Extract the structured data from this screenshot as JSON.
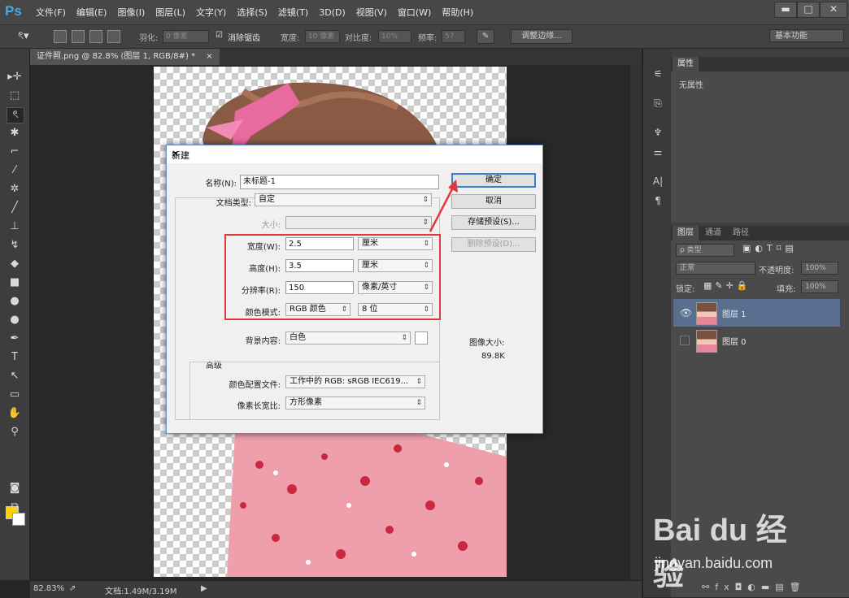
{
  "menubar": {
    "logo": "Ps",
    "items": [
      "文件(F)",
      "编辑(E)",
      "图像(I)",
      "图层(L)",
      "文字(Y)",
      "选择(S)",
      "滤镜(T)",
      "3D(D)",
      "视图(V)",
      "窗口(W)",
      "帮助(H)"
    ],
    "minimize": "▬",
    "maximize": "□",
    "close": "✕"
  },
  "options": {
    "feather_label": "羽化:",
    "feather_value": "0 像素",
    "antialias_label": "消除锯齿",
    "width_label": "宽度:",
    "width_value": "10 像素",
    "contrast_label": "对比度:",
    "contrast_value": "10%",
    "frequency_label": "频率:",
    "frequency_value": "57",
    "refine_edge": "调整边缘...",
    "workspace": "基本功能"
  },
  "document": {
    "tab_label": "证件照.png @ 82.8% (图层 1, RGB/8#) *",
    "tab_close": "×"
  },
  "status": {
    "zoom": "82.83%",
    "doc_info": "文档:1.49M/3.19M"
  },
  "properties": {
    "tab": "属性",
    "empty_text": "无属性"
  },
  "layers_panel": {
    "tabs": [
      "图层",
      "通道",
      "路径"
    ],
    "kind_filter": "ρ 类型",
    "blend_mode": "正常",
    "opacity_label": "不透明度:",
    "opacity_value": "100%",
    "lock_label": "锁定:",
    "fill_label": "填充:",
    "fill_value": "100%",
    "layers": [
      {
        "name": "图层 1",
        "visible": true
      },
      {
        "name": "图层 0",
        "visible": false
      }
    ]
  },
  "watermark": {
    "brand": "Bai du 经验",
    "url": "jingyan.baidu.com"
  },
  "dialog": {
    "title": "新建",
    "name_label": "名称(N):",
    "name_value": "未标题-1",
    "doctype_label": "文档类型:",
    "doctype_value": "自定",
    "size_label": "大小:",
    "size_value": "",
    "width_label": "宽度(W):",
    "width_value": "2.5",
    "width_unit": "厘米",
    "height_label": "高度(H):",
    "height_value": "3.5",
    "height_unit": "厘米",
    "resolution_label": "分辨率(R):",
    "resolution_value": "150",
    "resolution_unit": "像素/英寸",
    "colormode_label": "颜色模式:",
    "colormode_value": "RGB 颜色",
    "bitdepth_value": "8 位",
    "bg_label": "背景内容:",
    "bg_value": "白色",
    "advanced_label": "高级",
    "profile_label": "颜色配置文件:",
    "profile_value": "工作中的 RGB: sRGB IEC619...",
    "pixel_ratio_label": "像素长宽比:",
    "pixel_ratio_value": "方形像素",
    "ok": "确定",
    "cancel": "取消",
    "save_preset": "存储预设(S)...",
    "delete_preset": "删除预设(D)...",
    "image_size_label": "图像大小:",
    "image_size_value": "89.8K",
    "close": "✕"
  },
  "colors": {
    "foreground": "#f7d300",
    "background": "#ffffff",
    "highlight_box": "#e0393b",
    "selected_layer": "#5a6f8f"
  }
}
